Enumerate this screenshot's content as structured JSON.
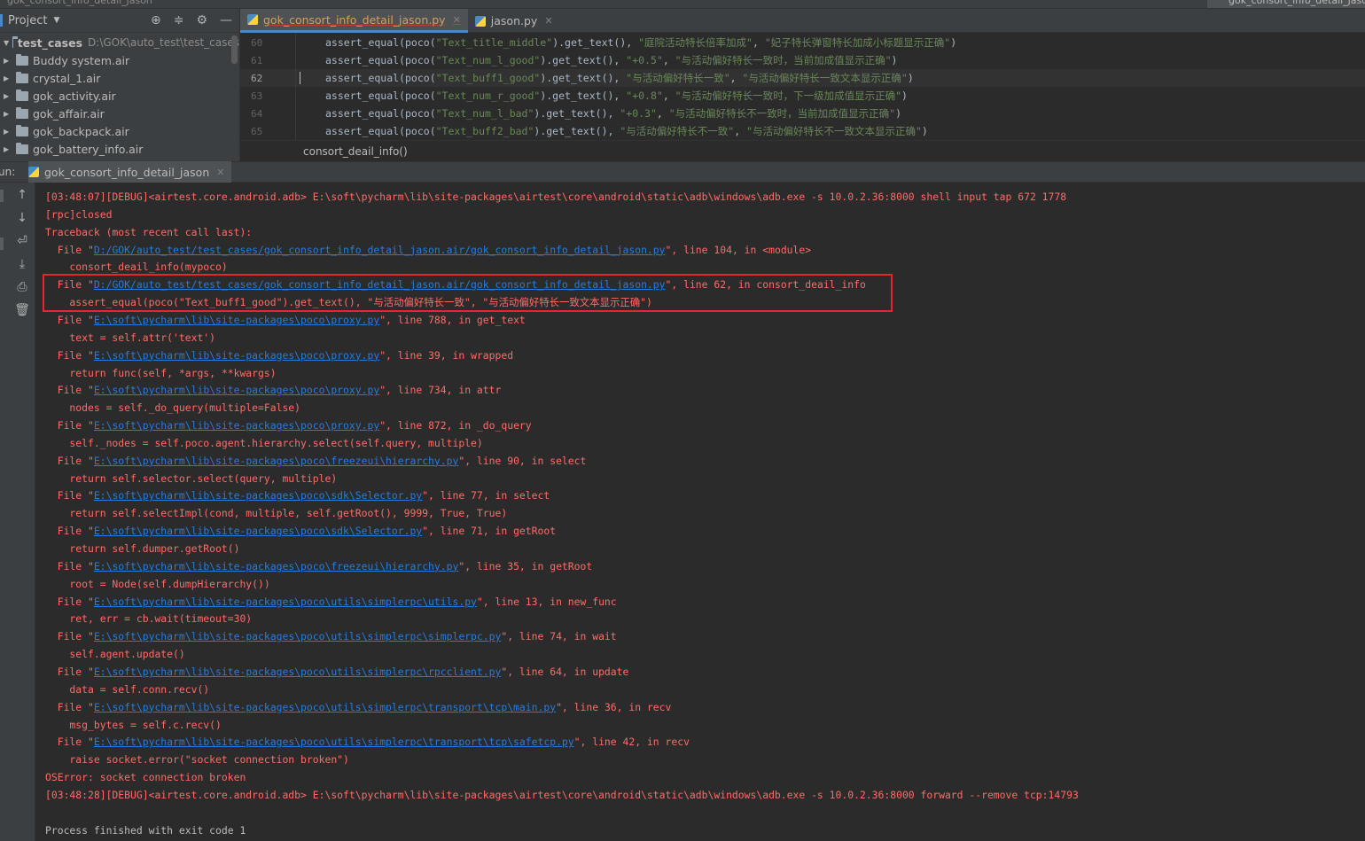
{
  "top_strip": {
    "breadcrumb": "gok_consort_info_detail_jason",
    "right_tab": "gok_consort_info_detail_jason"
  },
  "project_panel": {
    "title": "Project",
    "root": {
      "name": "test_cases",
      "path": "D:\\GOK\\auto_test\\test_cases"
    },
    "items": [
      "Buddy system.air",
      "crystal_1.air",
      "gok_activity.air",
      "gok_affair.air",
      "gok_backpack.air",
      "gok_battery_info.air"
    ]
  },
  "editor": {
    "tabs": [
      {
        "label": "gok_consort_info_detail_jason.py",
        "active": true
      },
      {
        "label": "jason.py",
        "active": false
      }
    ],
    "lines": [
      {
        "num": "60",
        "pre": "assert_equal(poco(",
        "s1": "\"Text_title_middle\"",
        "mid": ").get_text(), ",
        "s2": "\"庭院活动特长倍率加成\"",
        "sep": ", ",
        "s3": "\"妃子特长弹窗特长加成小标题显示正确\"",
        "post": ")"
      },
      {
        "num": "61",
        "pre": "assert_equal(poco(",
        "s1": "\"Text_num_l_good\"",
        "mid": ").get_text(), ",
        "s2": "\"+0.5\"",
        "sep": ", ",
        "s3": "\"与活动偏好特长一致时，当前加成值显示正确\"",
        "post": ")"
      },
      {
        "num": "62",
        "pre": "assert_equal(poco(",
        "s1": "\"Text_buff1_good\"",
        "mid": ").get_text(), ",
        "s2": "\"与活动偏好特长一致\"",
        "sep": ", ",
        "s3": "\"与活动偏好特长一致文本显示正确\"",
        "post": ")"
      },
      {
        "num": "63",
        "pre": "assert_equal(poco(",
        "s1": "\"Text_num_r_good\"",
        "mid": ").get_text(), ",
        "s2": "\"+0.8\"",
        "sep": ", ",
        "s3": "\"与活动偏好特长一致时，下一级加成值显示正确\"",
        "post": ")"
      },
      {
        "num": "64",
        "pre": "assert_equal(poco(",
        "s1": "\"Text_num_l_bad\"",
        "mid": ").get_text(), ",
        "s2": "\"+0.3\"",
        "sep": ", ",
        "s3": "\"与活动偏好特长不一致时，当前加成值显示正确\"",
        "post": ")"
      },
      {
        "num": "65",
        "pre": "assert_equal(poco(",
        "s1": "\"Text_buff2_bad\"",
        "mid": ").get_text(), ",
        "s2": "\"与活动偏好特长不一致\"",
        "sep": ", ",
        "s3": "\"与活动偏好特长不一致文本显示正确\"",
        "post": ")"
      }
    ],
    "breadcrumb": "consort_deail_info()"
  },
  "run_panel": {
    "label": "un:",
    "tab": "gok_consort_info_detail_jason"
  },
  "console": [
    {
      "t": "[03:48:07][DEBUG]<airtest.core.android.adb> E:\\soft\\pycharm\\lib\\site-packages\\airtest\\core\\android\\static\\adb\\windows\\adb.exe -s 10.0.2.36:8000 shell input tap 672 1778"
    },
    {
      "t": "[rpc]closed"
    },
    {
      "t": "Traceback (most recent call last):"
    },
    {
      "pre": "  File \"",
      "link": "D:/GOK/auto_test/test_cases/gok_consort_info_detail_jason.air/gok_consort_info_detail_jason.py",
      "post": "\", line 104, in <module>"
    },
    {
      "t": "    consort_deail_info(mypoco)"
    },
    {
      "pre": "  File \"",
      "link": "D:/GOK/auto_test/test_cases/gok_consort_info_detail_jason.air/gok_consort_info_detail_jason.py",
      "post": "\", line 62, in consort_deail_info"
    },
    {
      "t": "    assert_equal(poco(\"Text_buff1_good\").get_text(), \"与活动偏好特长一致\", \"与活动偏好特长一致文本显示正确\")"
    },
    {
      "pre": "  File \"",
      "link": "E:\\soft\\pycharm\\lib\\site-packages\\poco\\proxy.py",
      "post": "\", line 788, in get_text"
    },
    {
      "t": "    text = self.attr('text')"
    },
    {
      "pre": "  File \"",
      "link": "E:\\soft\\pycharm\\lib\\site-packages\\poco\\proxy.py",
      "post": "\", line 39, in wrapped"
    },
    {
      "t": "    return func(self, *args, **kwargs)"
    },
    {
      "pre": "  File \"",
      "link": "E:\\soft\\pycharm\\lib\\site-packages\\poco\\proxy.py",
      "post": "\", line 734, in attr"
    },
    {
      "t": "    nodes = self._do_query(multiple=False)"
    },
    {
      "pre": "  File \"",
      "link": "E:\\soft\\pycharm\\lib\\site-packages\\poco\\proxy.py",
      "post": "\", line 872, in _do_query"
    },
    {
      "t": "    self._nodes = self.poco.agent.hierarchy.select(self.query, multiple)"
    },
    {
      "pre": "  File \"",
      "link": "E:\\soft\\pycharm\\lib\\site-packages\\poco\\freezeui\\hierarchy.py",
      "post": "\", line 90, in select"
    },
    {
      "t": "    return self.selector.select(query, multiple)"
    },
    {
      "pre": "  File \"",
      "link": "E:\\soft\\pycharm\\lib\\site-packages\\poco\\sdk\\Selector.py",
      "post": "\", line 77, in select"
    },
    {
      "t": "    return self.selectImpl(cond, multiple, self.getRoot(), 9999, True, True)"
    },
    {
      "pre": "  File \"",
      "link": "E:\\soft\\pycharm\\lib\\site-packages\\poco\\sdk\\Selector.py",
      "post": "\", line 71, in getRoot"
    },
    {
      "t": "    return self.dumper.getRoot()"
    },
    {
      "pre": "  File \"",
      "link": "E:\\soft\\pycharm\\lib\\site-packages\\poco\\freezeui\\hierarchy.py",
      "post": "\", line 35, in getRoot"
    },
    {
      "t": "    root = Node(self.dumpHierarchy())"
    },
    {
      "pre": "  File \"",
      "link": "E:\\soft\\pycharm\\lib\\site-packages\\poco\\utils\\simplerpc\\utils.py",
      "post": "\", line 13, in new_func"
    },
    {
      "t": "    ret, err = cb.wait(timeout=30)"
    },
    {
      "pre": "  File \"",
      "link": "E:\\soft\\pycharm\\lib\\site-packages\\poco\\utils\\simplerpc\\simplerpc.py",
      "post": "\", line 74, in wait"
    },
    {
      "t": "    self.agent.update()"
    },
    {
      "pre": "  File \"",
      "link": "E:\\soft\\pycharm\\lib\\site-packages\\poco\\utils\\simplerpc\\rpcclient.py",
      "post": "\", line 64, in update"
    },
    {
      "t": "    data = self.conn.recv()"
    },
    {
      "pre": "  File \"",
      "link": "E:\\soft\\pycharm\\lib\\site-packages\\poco\\utils\\simplerpc\\transport\\tcp\\main.py",
      "post": "\", line 36, in recv"
    },
    {
      "t": "    msg_bytes = self.c.recv()"
    },
    {
      "pre": "  File \"",
      "link": "E:\\soft\\pycharm\\lib\\site-packages\\poco\\utils\\simplerpc\\transport\\tcp\\safetcp.py",
      "post": "\", line 42, in recv"
    },
    {
      "t": "    raise socket.error(\"socket connection broken\")"
    },
    {
      "t": "OSError: socket connection broken"
    },
    {
      "t": "[03:48:28][DEBUG]<airtest.core.android.adb> E:\\soft\\pycharm\\lib\\site-packages\\airtest\\core\\android\\static\\adb\\windows\\adb.exe -s 10.0.2.36:8000 forward --remove tcp:14793"
    },
    {
      "t": ""
    },
    {
      "t": "Process finished with exit code 1",
      "plain": true
    }
  ],
  "colors": {
    "error": "#ff6b68",
    "link": "#287bde",
    "highlight_box": "#e8242f",
    "string": "#6a8759"
  }
}
